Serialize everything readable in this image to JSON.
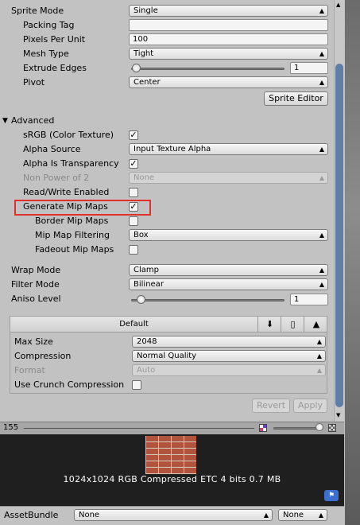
{
  "sprite": {
    "sprite_mode_label": "Sprite Mode",
    "sprite_mode_value": "Single",
    "packing_tag_label": "Packing Tag",
    "packing_tag_value": "",
    "pixels_per_unit_label": "Pixels Per Unit",
    "pixels_per_unit_value": "100",
    "mesh_type_label": "Mesh Type",
    "mesh_type_value": "Tight",
    "extrude_edges_label": "Extrude Edges",
    "extrude_edges_value": "1",
    "pivot_label": "Pivot",
    "pivot_value": "Center",
    "sprite_editor_button": "Sprite Editor"
  },
  "advanced": {
    "header": "Advanced",
    "srgb_label": "sRGB (Color Texture)",
    "srgb_checked": true,
    "alpha_source_label": "Alpha Source",
    "alpha_source_value": "Input Texture Alpha",
    "alpha_transparency_label": "Alpha Is Transparency",
    "alpha_transparency_checked": true,
    "non_power_label": "Non Power of 2",
    "non_power_value": "None",
    "read_write_label": "Read/Write Enabled",
    "read_write_checked": false,
    "generate_mip_label": "Generate Mip Maps",
    "generate_mip_checked": true,
    "border_mip_label": "Border Mip Maps",
    "border_mip_checked": false,
    "mip_filter_label": "Mip Map Filtering",
    "mip_filter_value": "Box",
    "fadeout_label": "Fadeout Mip Maps",
    "fadeout_checked": false
  },
  "wrap": {
    "wrap_mode_label": "Wrap Mode",
    "wrap_mode_value": "Clamp",
    "filter_mode_label": "Filter Mode",
    "filter_mode_value": "Bilinear",
    "aniso_label": "Aniso Level",
    "aniso_value": "1"
  },
  "platform": {
    "default_tab": "Default",
    "max_size_label": "Max Size",
    "max_size_value": "2048",
    "compression_label": "Compression",
    "compression_value": "Normal Quality",
    "format_label": "Format",
    "format_value": "Auto",
    "crunch_label": "Use Crunch Compression",
    "crunch_checked": false
  },
  "buttons": {
    "revert": "Revert",
    "apply": "Apply"
  },
  "preview": {
    "zoom_value": "155",
    "info": "1024x1024  RGB Compressed ETC 4 bits  0.7 MB"
  },
  "assetbundle": {
    "label": "AssetBundle",
    "name_value": "None",
    "variant_value": "None"
  },
  "icons": {
    "dropdown": "dropdown-arrow-icon",
    "check": "checkmark-icon",
    "download": "download-icon",
    "phone": "phone-icon",
    "android": "android-icon",
    "tag": "tag-icon",
    "collapse": "triangle-down-icon"
  },
  "colors": {
    "highlight_box": "#e0302e",
    "scroll_thumb": "#5f7ea8",
    "inspector_bg": "#c2c2c2"
  }
}
